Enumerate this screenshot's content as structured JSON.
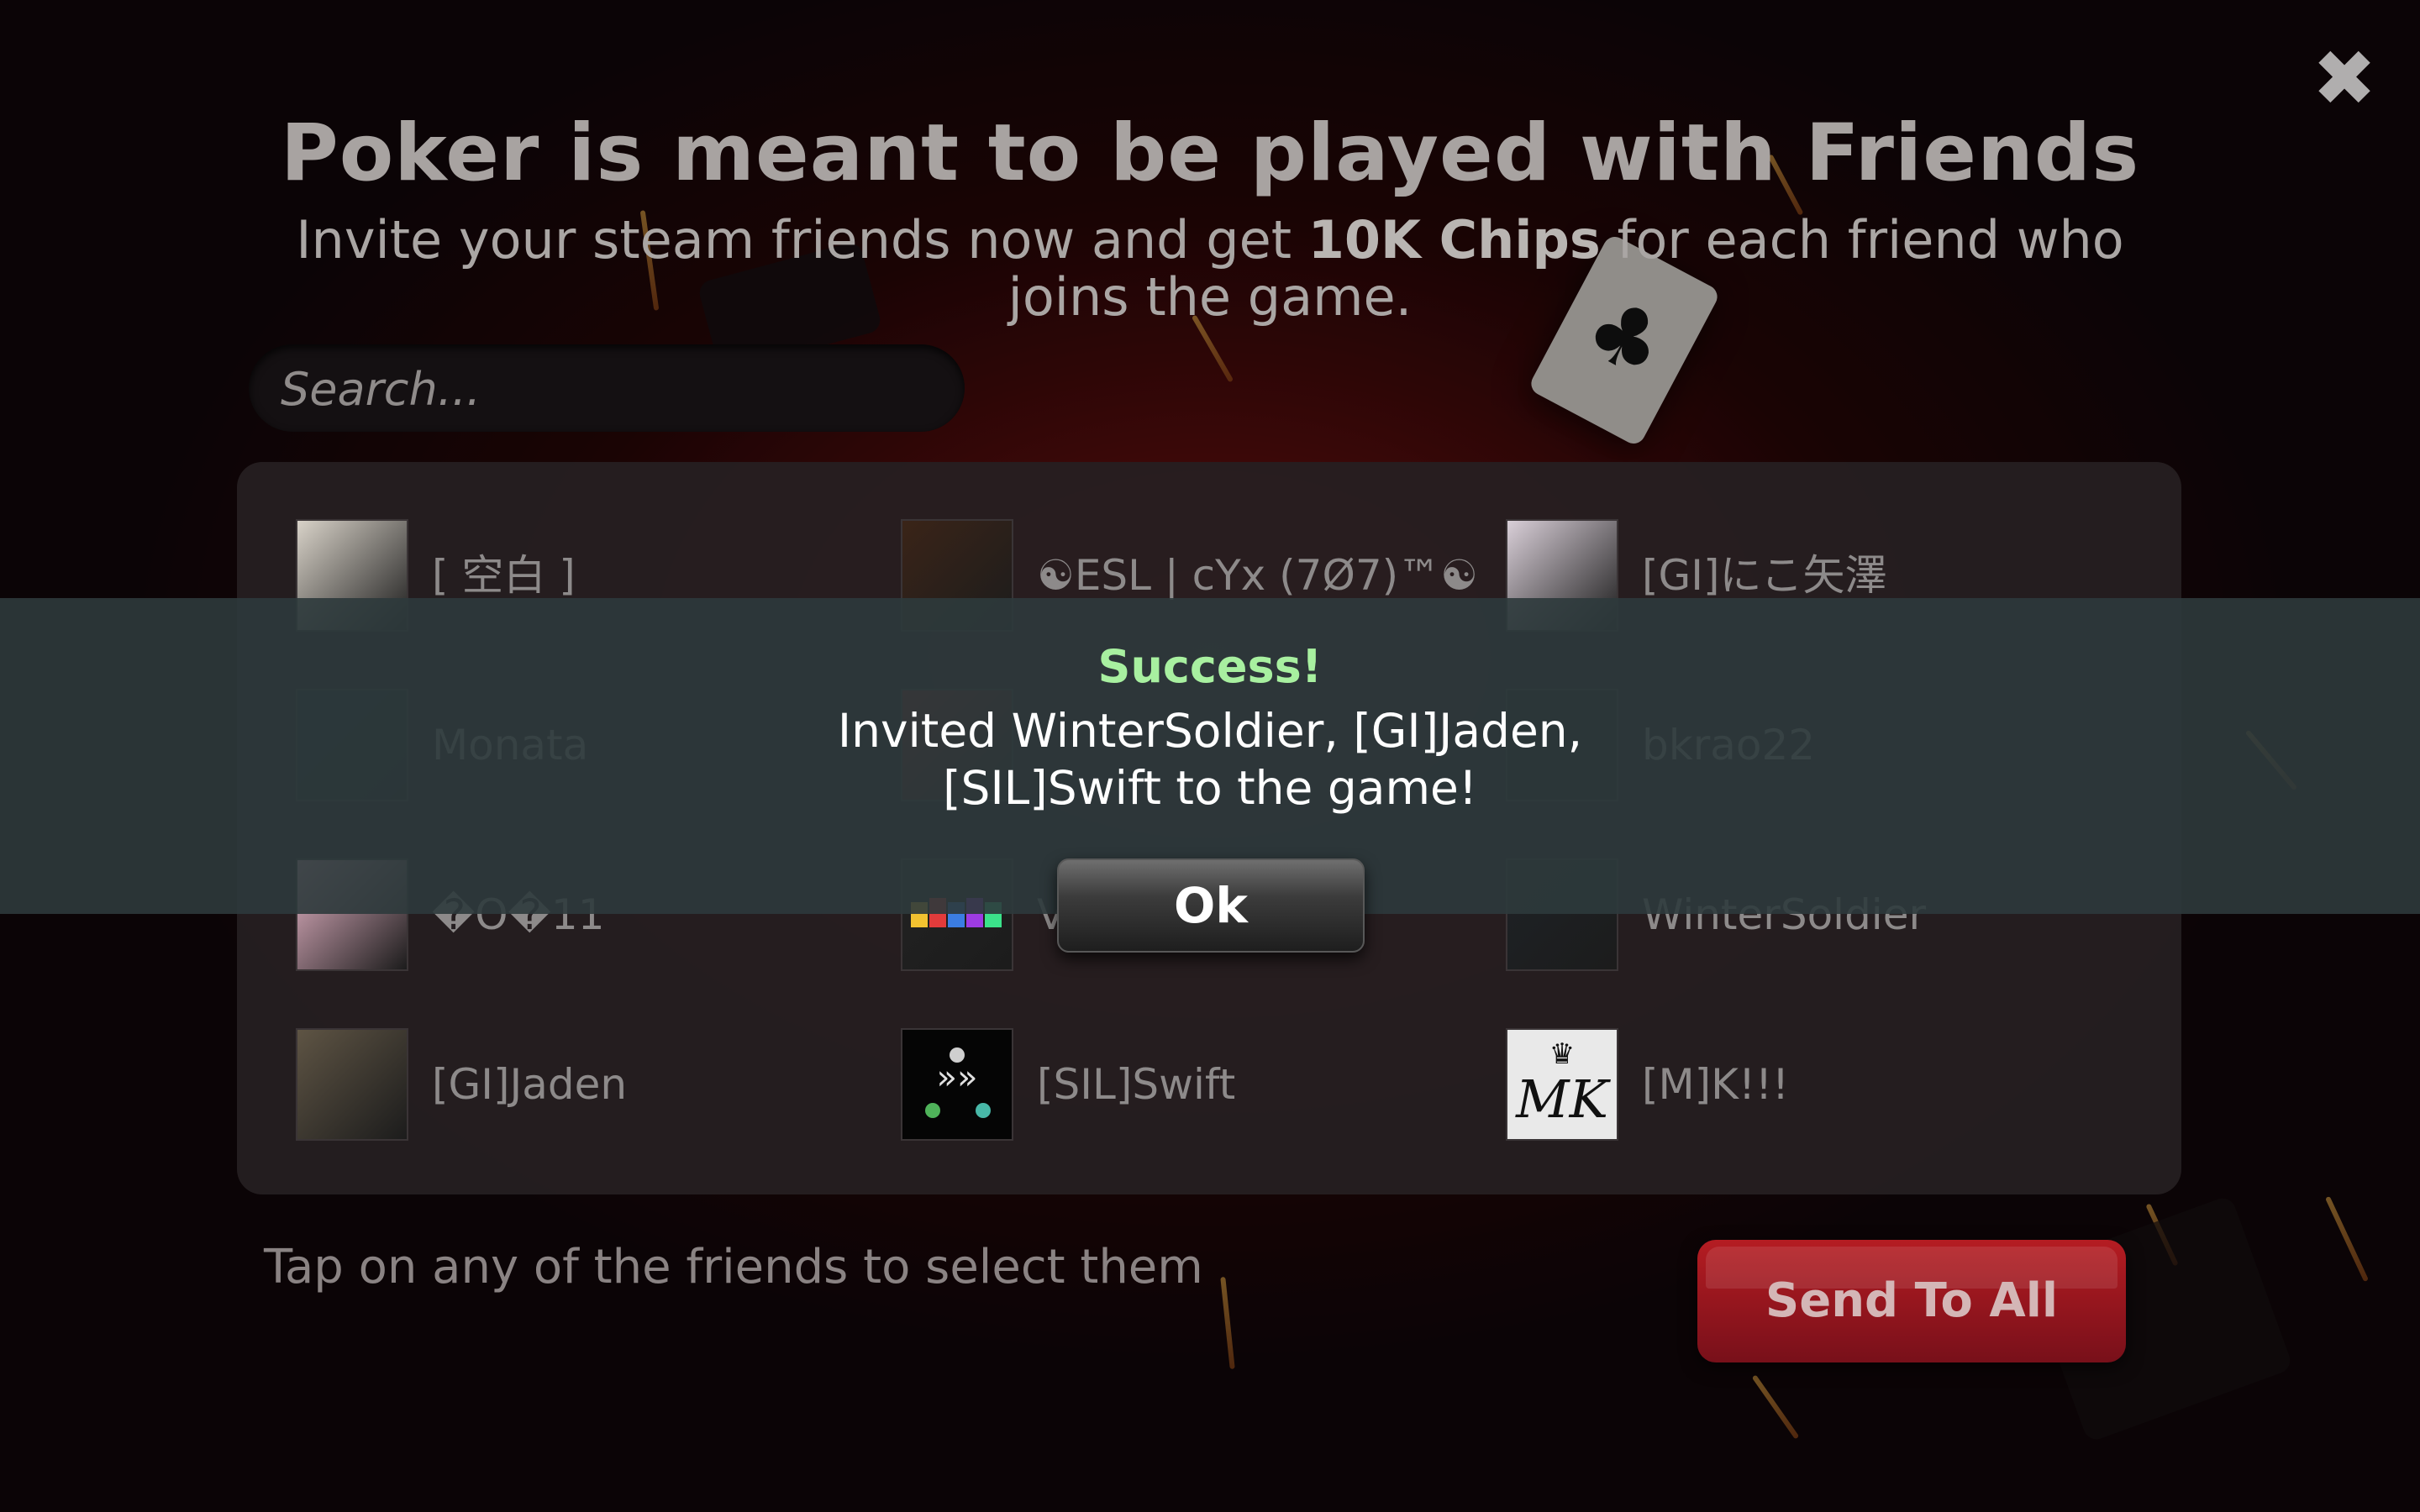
{
  "header": {
    "title": "Poker is meant to be played with Friends",
    "subtitle_pre": "Invite your steam friends now and get ",
    "subtitle_bold": "10K Chips",
    "subtitle_post": " for each friend who joins the game."
  },
  "search": {
    "placeholder": "Search..."
  },
  "friends": [
    {
      "name": "[ 空白 ]",
      "avatar": "person-with-guitar",
      "color": "#d8d2c8"
    },
    {
      "name": "☯ESL | cYx (7Ø7)™☯",
      "avatar": "masked-face",
      "color": "#3a2418"
    },
    {
      "name": "[GI]にこ矢澤",
      "avatar": "anime-girl",
      "color": "#d9cfd8"
    },
    {
      "name": "Monata",
      "avatar": "dark-anime",
      "color": "#1d2430"
    },
    {
      "name": "",
      "avatar": "red-art",
      "color": "#7a1c1c"
    },
    {
      "name": "bkrao22",
      "avatar": "dark",
      "color": "#1a1a1a"
    },
    {
      "name": "�O�11",
      "avatar": "pink-anime",
      "color": "#e8b6c8"
    },
    {
      "name": "V",
      "avatar": "colorful-logo",
      "color": "#222222"
    },
    {
      "name": "WinterSoldier",
      "avatar": "soldier-dark",
      "color": "#1e2226"
    },
    {
      "name": "[GI]Jaden",
      "avatar": "soldiers",
      "color": "#5e5444"
    },
    {
      "name": "[SIL]Swift",
      "avatar": "swift-logo",
      "color": "#050505"
    },
    {
      "name": "[M]K!!!",
      "avatar": "crown-monogram",
      "color": "#e9e9e9"
    }
  ],
  "hint": "Tap on any of the friends to select them",
  "send_all_label": "Send To All",
  "close_label": "✖",
  "dialog": {
    "title": "Success!",
    "message": "Invited  WinterSoldier, [GI]Jaden, [SIL]Swift to the game!",
    "ok_label": "Ok"
  }
}
